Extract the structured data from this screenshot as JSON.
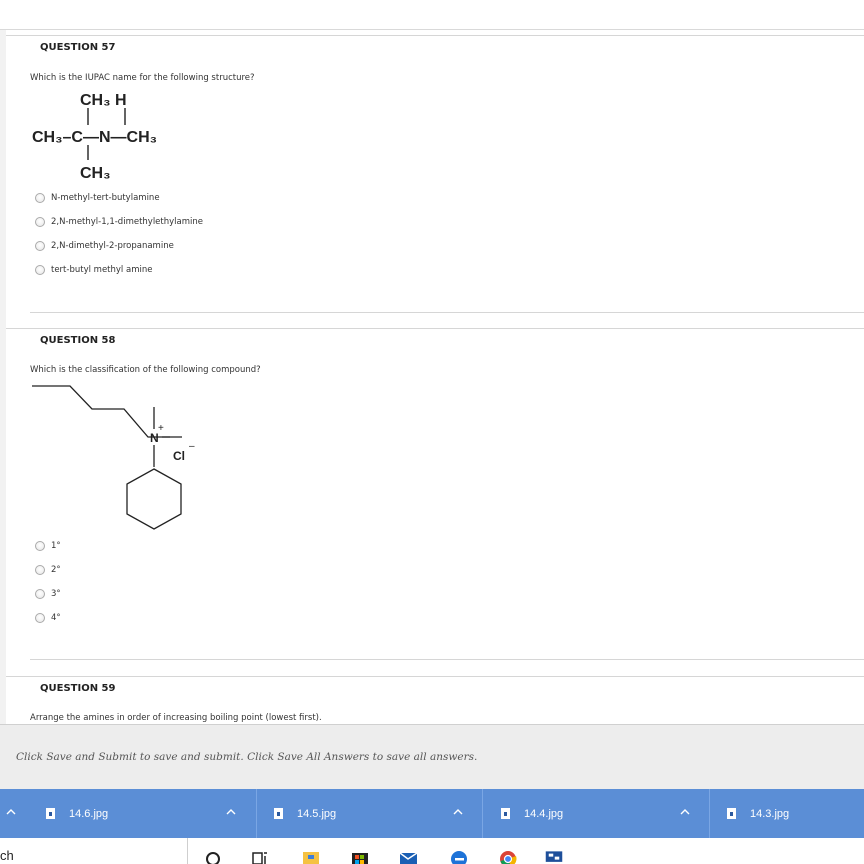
{
  "q57": {
    "title": "QUESTION 57",
    "prompt": "Which is the IUPAC name for the following structure?",
    "structure": {
      "top_labels": "CH₃ H",
      "main_chain": "CH₃–C—N—CH₃",
      "bottom_label": "CH₃"
    },
    "options": [
      "N-methyl-tert-butylamine",
      "2,N-methyl-1,1-dimethylethylamine",
      "2,N-dimethyl-2-propanamine",
      "tert-butyl methyl amine"
    ]
  },
  "q58": {
    "title": "QUESTION 58",
    "prompt": "Which is the classification of the following compound?",
    "structure": {
      "n_label": "N",
      "plus": "+",
      "cl_label": "Cl",
      "minus": "–"
    },
    "options": [
      "1°",
      "2°",
      "3°",
      "4°"
    ]
  },
  "q59": {
    "title": "QUESTION 59",
    "prompt": "Arrange the amines in order of increasing boiling point (lowest first)."
  },
  "submit_bar": {
    "text": "Click Save and Submit to save and submit. Click Save All Answers to save all answers."
  },
  "downloads": [
    {
      "name": "14.6.jpg"
    },
    {
      "name": "14.5.jpg"
    },
    {
      "name": "14.4.jpg"
    },
    {
      "name": "14.3.jpg"
    }
  ],
  "taskbar": {
    "search_text": "ch",
    "icons": [
      "cortana-circle-icon",
      "task-view-icon",
      "file-explorer-icon",
      "store-icon",
      "mail-icon",
      "edge-icon",
      "chrome-icon",
      "network-app-icon"
    ]
  },
  "colors": {
    "download_bar": "#5b8ed6",
    "submit_bar": "#ededed"
  }
}
